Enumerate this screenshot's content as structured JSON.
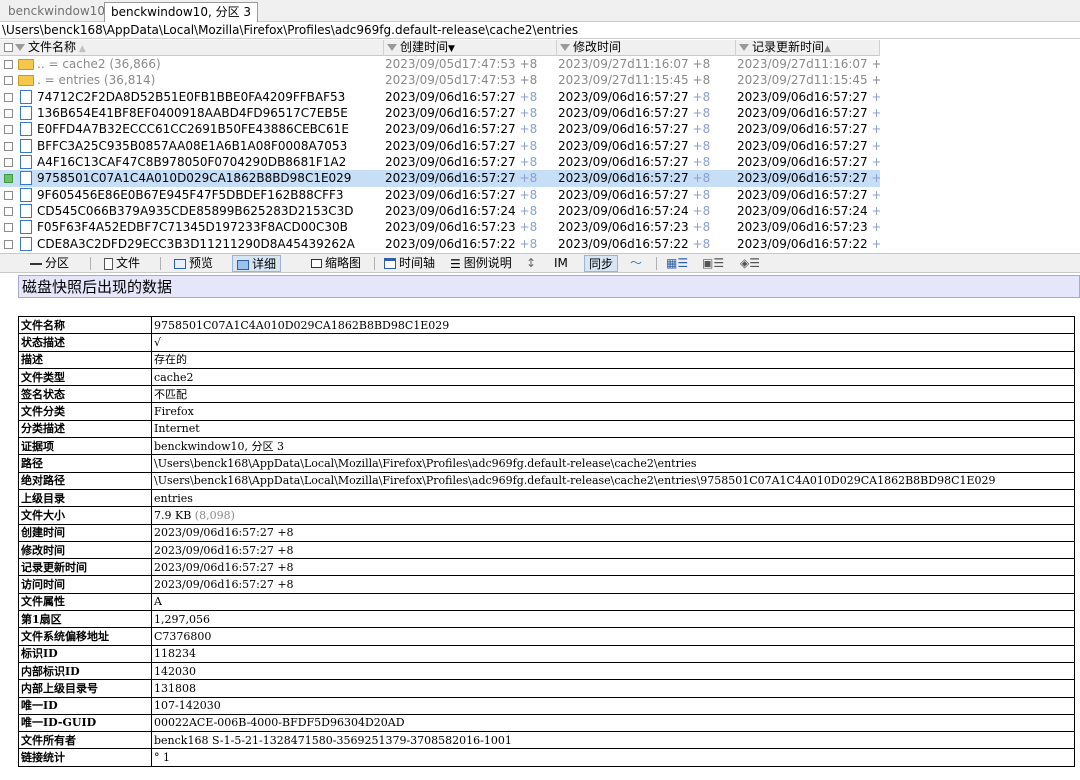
{
  "tabs": [
    "benckwindow10",
    "benckwindow10, 分区 3"
  ],
  "path": "\\Users\\benck168\\AppData\\Local\\Mozilla\\Firefox\\Profiles\\adc969fg.default-release\\cache2\\entries",
  "file_table": {
    "headers": {
      "name": "文件名称",
      "created": "创建时间",
      "modified": "修改时间",
      "record_updated": "记录更新时间"
    },
    "rows": [
      {
        "icon": "folder-icon",
        "name": "..  =  cache2",
        "count": "(36,866)",
        "created": "2023/09/05d17:47:53",
        "modified": "2023/09/27d11:16:07",
        "record_updated": "2023/09/27d11:16:07",
        "dir": true
      },
      {
        "icon": "folder-icon",
        "name": ".   =  entries",
        "count": "(36,814)",
        "created": "2023/09/05d17:47:53",
        "modified": "2023/09/27d11:15:45",
        "record_updated": "2023/09/27d11:15:45",
        "dir": true
      },
      {
        "icon": "file-icon",
        "name": "74712C2F2DA8D52B51E0FB1BBE0FA4209FFBAF53",
        "count": "",
        "created": "2023/09/06d16:57:27",
        "modified": "2023/09/06d16:57:27",
        "record_updated": "2023/09/06d16:57:27",
        "dir": false
      },
      {
        "icon": "file-icon",
        "name": "136B654E41BF8EF0400918AABD4FD96517C7EB5E",
        "count": "",
        "created": "2023/09/06d16:57:27",
        "modified": "2023/09/06d16:57:27",
        "record_updated": "2023/09/06d16:57:27",
        "dir": false
      },
      {
        "icon": "file-icon",
        "name": "E0FFD4A7B32ECCC61CC2691B50FE43886CEBC61E",
        "count": "",
        "created": "2023/09/06d16:57:27",
        "modified": "2023/09/06d16:57:27",
        "record_updated": "2023/09/06d16:57:27",
        "dir": false
      },
      {
        "icon": "file-icon",
        "name": "BFFC3A25C935B0857AA08E1A6B1A08F0008A7053",
        "count": "",
        "created": "2023/09/06d16:57:27",
        "modified": "2023/09/06d16:57:27",
        "record_updated": "2023/09/06d16:57:27",
        "dir": false
      },
      {
        "icon": "file-icon",
        "name": "A4F16C13CAF47C8B978050F0704290DB8681F1A2",
        "count": "",
        "created": "2023/09/06d16:57:27",
        "modified": "2023/09/06d16:57:27",
        "record_updated": "2023/09/06d16:57:27",
        "dir": false
      },
      {
        "icon": "file-icon",
        "name": "9758501C07A1C4A010D029CA1862B8BD98C1E029",
        "count": "",
        "created": "2023/09/06d16:57:27",
        "modified": "2023/09/06d16:57:27",
        "record_updated": "2023/09/06d16:57:27",
        "dir": false,
        "selected": true
      },
      {
        "icon": "file-icon",
        "name": "9F605456E86E0B67E945F47F5DBDEF162B88CFF3",
        "count": "",
        "created": "2023/09/06d16:57:27",
        "modified": "2023/09/06d16:57:27",
        "record_updated": "2023/09/06d16:57:27",
        "dir": false
      },
      {
        "icon": "file-icon",
        "name": "CD545C066B379A935CDE85899B625283D2153C3D",
        "count": "",
        "created": "2023/09/06d16:57:24",
        "modified": "2023/09/06d16:57:24",
        "record_updated": "2023/09/06d16:57:24",
        "dir": false
      },
      {
        "icon": "file-icon",
        "name": "F05F63F4A52EDBF7C71345D197233F8ACD00C30B",
        "count": "",
        "created": "2023/09/06d16:57:23",
        "modified": "2023/09/06d16:57:23",
        "record_updated": "2023/09/06d16:57:23",
        "dir": false
      },
      {
        "icon": "file-icon",
        "name": "CDE8A3C2DFD29ECC3B3D11211290D8A45439262A",
        "count": "",
        "created": "2023/09/06d16:57:22",
        "modified": "2023/09/06d16:57:22",
        "record_updated": "2023/09/06d16:57:22",
        "dir": false
      }
    ],
    "tz_suffix": "+8"
  },
  "toolbar": {
    "partition": "分区",
    "file": "文件",
    "preview": "预览",
    "details": "详细",
    "thumbnail": "缩略图",
    "timeline": "时间轴",
    "legend": "图例说明",
    "im": "IM",
    "sync": "同步"
  },
  "section_title": "磁盘快照后出现的数据",
  "properties": [
    {
      "label": "文件名称",
      "value": "9758501C07A1C4A010D029CA1862B8BD98C1E029"
    },
    {
      "label": "状态描述",
      "value": "√"
    },
    {
      "label": "描述",
      "value": "存在的"
    },
    {
      "label": "文件类型",
      "value": "cache2"
    },
    {
      "label": "签名状态",
      "value": "不匹配"
    },
    {
      "label": "文件分类",
      "value": "Firefox"
    },
    {
      "label": "分类描述",
      "value": "Internet"
    },
    {
      "label": "证据项",
      "value": "benckwindow10, 分区 3"
    },
    {
      "label": "路径",
      "value": "\\Users\\benck168\\AppData\\Local\\Mozilla\\Firefox\\Profiles\\adc969fg.default-release\\cache2\\entries"
    },
    {
      "label": "绝对路径",
      "value": "\\Users\\benck168\\AppData\\Local\\Mozilla\\Firefox\\Profiles\\adc969fg.default-release\\cache2\\entries\\9758501C07A1C4A010D029CA1862B8BD98C1E029"
    },
    {
      "label": "上级目录",
      "value": "entries"
    },
    {
      "label": "文件大小",
      "value": "7.9 KB",
      "extra": "(8,098)"
    },
    {
      "label": "创建时间",
      "value": "2023/09/06d16:57:27 +8"
    },
    {
      "label": "修改时间",
      "value": "2023/09/06d16:57:27 +8"
    },
    {
      "label": "记录更新时间",
      "value": "2023/09/06d16:57:27 +8"
    },
    {
      "label": "访问时间",
      "value": "2023/09/06d16:57:27 +8"
    },
    {
      "label": "文件属性",
      "value": "A"
    },
    {
      "label": "第1扇区",
      "value": "1,297,056"
    },
    {
      "label": "文件系统偏移地址",
      "value": "C7376800"
    },
    {
      "label": "标识ID",
      "value": "118234"
    },
    {
      "label": "内部标识ID",
      "value": "142030"
    },
    {
      "label": "内部上级目录号",
      "value": "131808"
    },
    {
      "label": "唯一ID",
      "value": "107-142030"
    },
    {
      "label": "唯一ID-GUID",
      "value": "00022ACE-006B-4000-BFDF5D96304D20AD"
    },
    {
      "label": "文件所有者",
      "value": "benck168 S-1-5-21-1328471580-3569251379-3708582016-1001"
    },
    {
      "label": "链接统计",
      "value": "° 1"
    }
  ],
  "colors": {
    "selection": "#c6def6",
    "section_bg": "#e6e6fa",
    "timezone": "#8a9fd0"
  }
}
